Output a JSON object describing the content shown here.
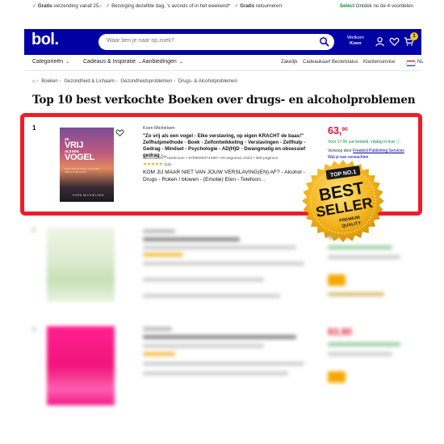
{
  "promo": {
    "left_1_bold": "Gratis",
    "left_1": " verzending vanaf 25,-",
    "left_2": "Bezorging dezelfde dag, 's avonds of in het weekend*",
    "left_3_bold": "Gratis",
    "left_3": " retourneren",
    "right_bold": "Select",
    "right": " Ontdek nu de 4 voordelen"
  },
  "header": {
    "logo": "bol.",
    "search_placeholder": "Waar ben je naar op zoek?",
    "welkom": "Welkom",
    "user": "Koen",
    "cart_count": "1"
  },
  "nav": {
    "items": [
      "Categorieën",
      "Cadeaus & Inspiratie",
      "Aanbiedingen"
    ],
    "right": [
      "Zakelijk",
      "Cadeaukaart",
      "Bestelstatus",
      "Klantenservice",
      "NL"
    ]
  },
  "breadcrumb": [
    "Boeken",
    "Gezondheid & Lichaam",
    "Gezondheidsproblemen",
    "Drugs- & Alcoholproblemen"
  ],
  "page_title": "Top 10 best verkochte Boeken over drugs- en alcoholproblemen",
  "product": {
    "rank": "1",
    "cover": {
      "line1": "ZE",
      "line2": "VRIJ",
      "line2b": "ALS EEN",
      "line3": "VOGEL",
      "subtitle": "ELKE VERSLAVING, OP EIGEN KRACHT DE BAAS!",
      "author": "KOEN MICHIELSEN"
    },
    "author": "Koen Michielsen",
    "title": "\"Zo vrij als een vogel - Elke verslaving, op eigen KRACHT de baas!\" Zelfhulpmethode - Boek - Zelfontwikkeling - Verslavingen - Zelfhulp - Gedrag - Mindset - Psychologie - AD(H)D - Dwangmatig en obsessief gedrag -...",
    "meta": "Nederlands • Hardcover • 9789090374499 • 09 augustus 2023 • 368 pagina's",
    "stars": "★★★★★",
    "reviews": "(14)",
    "description": "KOM JIJ MAAR NIET VAN JOUW VERSLAVING(EN) AF? - Alcohol - Drugs - Roken / blowen - (Emotie) Eten - Telefoon...",
    "price_whole": "63,",
    "price_cents": "90",
    "delivery": "Voor 17:00 uur besteld, vrijdag in huis",
    "seller_label": "Verkoop door ",
    "seller_name": "Freebird Publishing Services",
    "warn": "Wat je kan verwachten"
  },
  "badge": {
    "top": "TOP NO.1",
    "line1": "BEST",
    "line2": "SELLER",
    "premium": "PREMIUM",
    "quality": "QUALITY"
  },
  "blurred_rows": [
    {
      "rank": "2",
      "price": "32,99"
    },
    {
      "rank": "3",
      "price": "63,90"
    }
  ],
  "colors": {
    "brand_blue": "#0000a4",
    "highlight_red": "#ef1c27",
    "price_red": "#e5112b",
    "green": "#0b8a3c",
    "badge_gold": "#f3b41b"
  }
}
